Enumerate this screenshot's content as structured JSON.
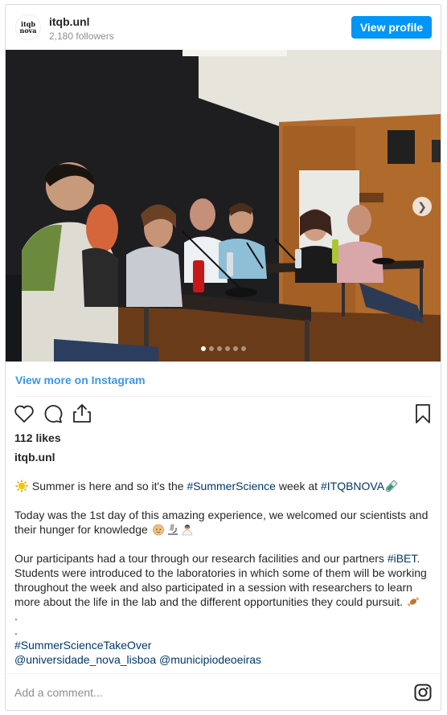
{
  "header": {
    "avatar_text": "itqb nova",
    "username": "itqb.unl",
    "followers": "2,180 followers",
    "view_profile_label": "View profile"
  },
  "media": {
    "carousel_total": 6,
    "carousel_active_index": 0,
    "next_icon": "chevron-right-icon"
  },
  "links": {
    "view_more": "View more on Instagram"
  },
  "actions": {
    "icons": [
      "heart-icon",
      "comment-icon",
      "share-icon",
      "bookmark-icon"
    ]
  },
  "likes": "112 likes",
  "author": "itqb.unl",
  "caption": {
    "p1_a": " Summer is here and so it's the ",
    "p1_tag1": "#SummerScience",
    "p1_b": " week at ",
    "p1_tag2": "#ITQBNOVA",
    "p2": "Today was the 1st day of this amazing experience, we welcomed our scientists and their hunger for knowledge ",
    "p3_a": "Our participants had a tour through our research facilities and our partners ",
    "p3_tag": "#iBET",
    "p3_b": ". Students were introduced to the laboratories in which some of them will be working throughout the week and also participated in a session with researchers to learn more about the life in the lab and the different opportunities they could pursuit. ",
    "dot1": ".",
    "dot2": ".",
    "tag_line": "#SummerScienceTakeOver",
    "mention1": "@universidade_nova_lisboa",
    "mention2": "@municipiodeoeiras"
  },
  "comment": {
    "placeholder": "Add a comment..."
  },
  "footer": {
    "icon": "instagram-icon"
  },
  "colors": {
    "primary": "#0095f6",
    "link": "#3897f0",
    "hashtag": "#00376b",
    "muted": "#8e8e8e"
  }
}
